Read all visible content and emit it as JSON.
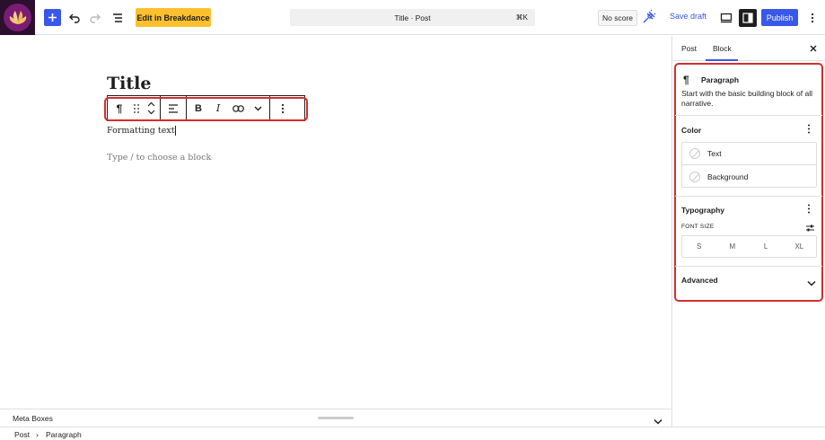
{
  "header": {
    "breakdance_label": "Edit in Breakdance",
    "command_title": "Title · Post",
    "command_shortcut": "⌘K",
    "score_label": "No score",
    "save_draft_label": "Save draft",
    "publish_label": "Publish"
  },
  "editor": {
    "post_title": "Title",
    "paragraph_text": "Formatting text",
    "placeholder": "Type / to choose a block"
  },
  "meta_boxes": {
    "label": "Meta Boxes"
  },
  "breadcrumb": {
    "items": [
      "Post",
      "Paragraph"
    ]
  },
  "sidebar": {
    "tabs": [
      "Post",
      "Block"
    ],
    "active_tab": "Block",
    "block": {
      "name": "Paragraph",
      "description": "Start with the basic building block of all narrative."
    },
    "color": {
      "title": "Color",
      "items": [
        "Text",
        "Background"
      ]
    },
    "typography": {
      "title": "Typography",
      "font_size_label": "FONT SIZE",
      "sizes": [
        "S",
        "M",
        "L",
        "XL"
      ]
    },
    "advanced": {
      "title": "Advanced"
    }
  },
  "colors": {
    "accent": "#3858e9",
    "breakdance": "#fbc02d",
    "highlight_box": "#d32f2f",
    "logo_bg": "#7a1c74"
  }
}
